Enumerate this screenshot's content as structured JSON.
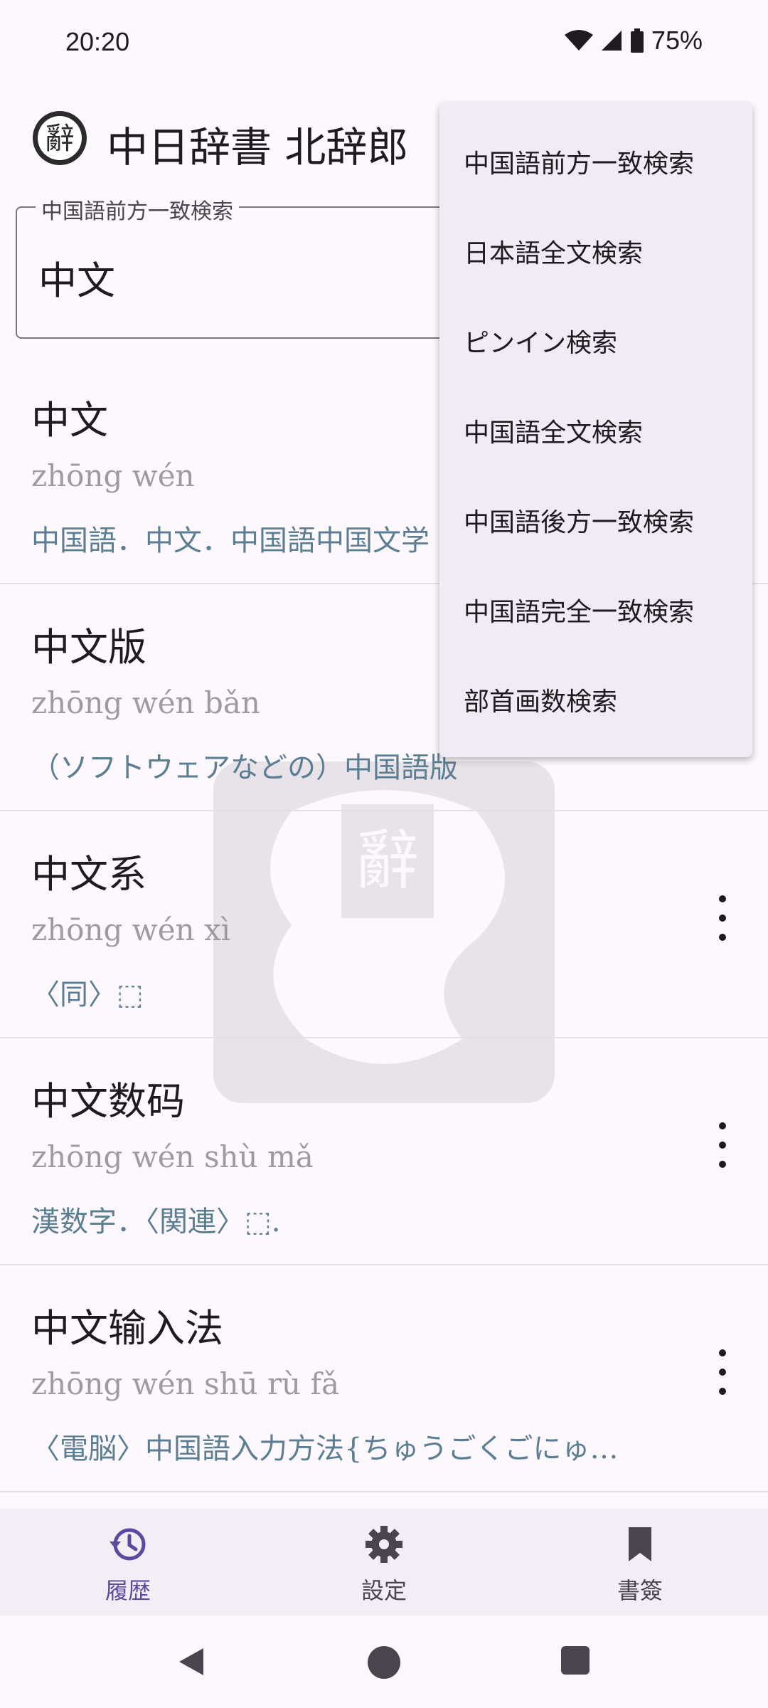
{
  "status": {
    "time": "20:20",
    "battery": "75%"
  },
  "app": {
    "title": "中日辞書 北辞郎",
    "logo_char": "辭"
  },
  "search": {
    "label": "中国語前方一致検索",
    "value": "中文"
  },
  "results": [
    {
      "word": "中文",
      "pinyin": "zhōng wén",
      "definition": "中国語．中文．中国語中国文学"
    },
    {
      "word": "中文版",
      "pinyin": "zhōng wén bǎn",
      "definition": "（ソフトウェアなどの）中国語版"
    },
    {
      "word": "中文系",
      "pinyin": "zhōng wén xì",
      "definition": "〈同〉⬚"
    },
    {
      "word": "中文数码",
      "pinyin": "zhōng wén shù mǎ",
      "definition": "漢数字．〈関連〉⬚."
    },
    {
      "word": "中文输入法",
      "pinyin": "zhōng wén shū rù fǎ",
      "definition": "〈電脳〉中国語入力方法{ちゅうごくごにゅ…"
    }
  ],
  "menu": {
    "items": [
      "中国語前方一致検索",
      "日本語全文検索",
      "ピンイン検索",
      "中国語全文検索",
      "中国語後方一致検索",
      "中国語完全一致検索",
      "部首画数検索"
    ]
  },
  "bottom_nav": {
    "history": "履歴",
    "settings": "設定",
    "bookmarks": "書簽"
  },
  "colors": {
    "accent": "#5b4ba0",
    "definition": "#5b7e92",
    "pinyin": "#9e9aa2",
    "menu_bg": "#f0ebf4"
  }
}
